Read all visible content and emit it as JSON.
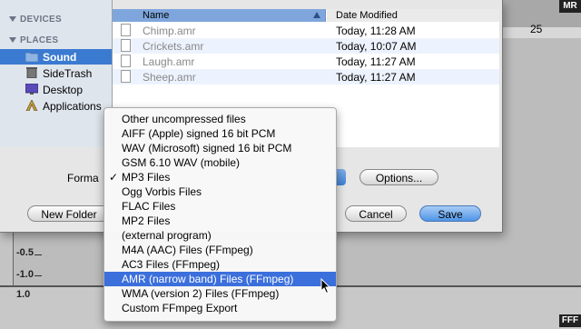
{
  "background": {
    "ruler_number": "25",
    "scale_labels": [
      "-0.5",
      "-1.0",
      "1.0"
    ],
    "logo_top": "MR",
    "logo_bottom": "FFF"
  },
  "sidebar": {
    "devices_label": "DEVICES",
    "places_label": "PLACES",
    "items": [
      {
        "label": "Sound",
        "icon": "folder-icon",
        "selected": true
      },
      {
        "label": "SideTrash",
        "icon": "trash-icon",
        "selected": false
      },
      {
        "label": "Desktop",
        "icon": "desktop-icon",
        "selected": false
      },
      {
        "label": "Applications",
        "icon": "applications-icon",
        "selected": false
      }
    ]
  },
  "file_list": {
    "columns": [
      "Name",
      "Date Modified"
    ],
    "rows": [
      {
        "name": "Chimp.amr",
        "date": "Today, 11:28 AM"
      },
      {
        "name": "Crickets.amr",
        "date": "Today, 10:07 AM"
      },
      {
        "name": "Laugh.amr",
        "date": "Today, 11:27 AM"
      },
      {
        "name": "Sheep.amr",
        "date": "Today, 11:27 AM"
      }
    ]
  },
  "format": {
    "label": "Forma",
    "options_button": "Options..."
  },
  "buttons": {
    "new_folder": "New Folder",
    "cancel": "Cancel",
    "save": "Save"
  },
  "format_menu": {
    "checked_index": 4,
    "highlighted_index": 11,
    "items": [
      "Other uncompressed files",
      "AIFF (Apple) signed 16 bit PCM",
      "WAV (Microsoft) signed 16 bit PCM",
      "GSM 6.10 WAV (mobile)",
      "MP3 Files",
      "Ogg Vorbis Files",
      "FLAC Files",
      "MP2 Files",
      "(external program)",
      "M4A (AAC) Files (FFmpeg)",
      "AC3 Files (FFmpeg)",
      "AMR (narrow band) Files (FFmpeg)",
      "WMA (version 2) Files (FFmpeg)",
      "Custom FFmpeg Export"
    ],
    "check_glyph": "✓"
  },
  "colors": {
    "selection": "#3b7ad1",
    "menu_highlight": "#3b6fdc",
    "primary_button": "#4f94e6"
  }
}
